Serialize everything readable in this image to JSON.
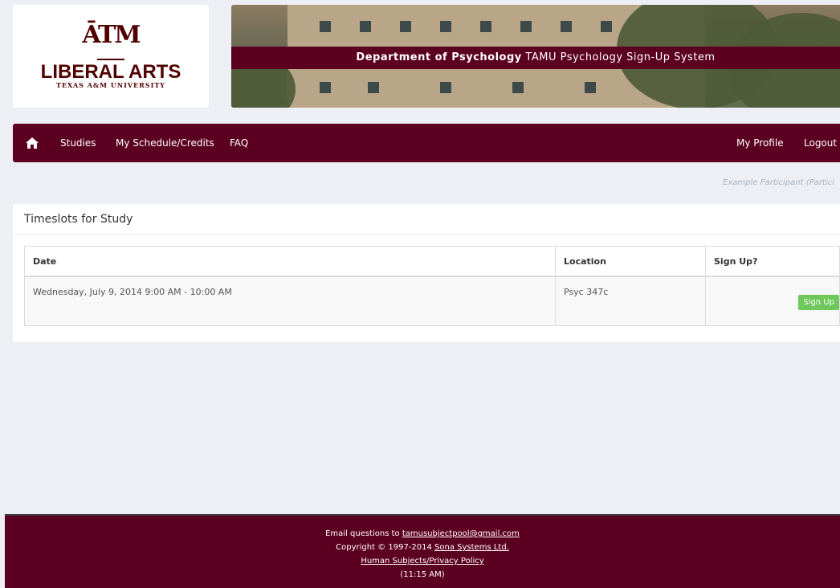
{
  "logo": {
    "atm": "ĀTM",
    "name": "LIBERAL ARTS",
    "sub": "TEXAS A&M UNIVERSITY"
  },
  "banner": {
    "dept": "Department of Psychology",
    "system": "TAMU Psychology Sign-Up System"
  },
  "nav": {
    "home_icon": "home-icon",
    "studies": "Studies",
    "schedule": "My Schedule/Credits",
    "faq": "FAQ",
    "profile": "My Profile",
    "logout": "Logout"
  },
  "user": {
    "label": "Example Participant (Partici"
  },
  "panel": {
    "title": "Timeslots for Study",
    "columns": [
      "Date",
      "Location",
      "Sign Up?"
    ],
    "rows": [
      {
        "date": "Wednesday, July 9, 2014 9:00 AM - 10:00 AM",
        "location": "Psyc 347c",
        "button": "Sign Up"
      }
    ]
  },
  "footer": {
    "email_prefix": "Email questions to ",
    "email": "tamusubjectpool@gmail.com",
    "copyright_prefix": "Copyright © 1997-2014 ",
    "company": "Sona Systems Ltd.",
    "policy": "Human Subjects/Privacy Policy",
    "time": "(11:15 AM)"
  },
  "colors": {
    "maroon": "#5c0021",
    "button_green": "#6ec85b",
    "background": "#edeff4"
  }
}
